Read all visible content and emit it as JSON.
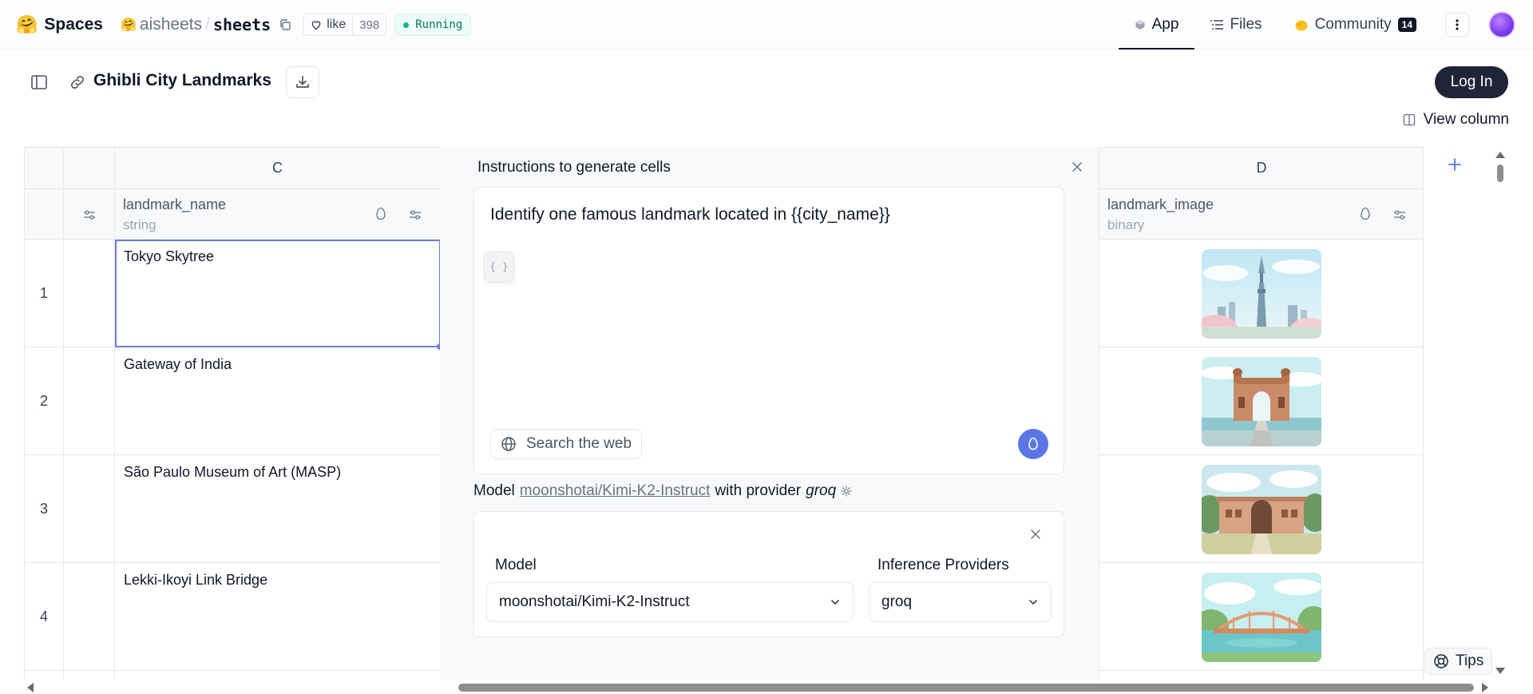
{
  "topbar": {
    "spaces_label": "Spaces",
    "owner": "aisheets",
    "separator": "/",
    "repo": "sheets",
    "like_label": "like",
    "like_count": "398",
    "status": "Running",
    "tabs": [
      {
        "label": "App"
      },
      {
        "label": "Files"
      },
      {
        "label": "Community",
        "badge": "14"
      }
    ]
  },
  "header": {
    "title": "Ghibli City Landmarks",
    "login_label": "Log In",
    "view_column_label": "View column"
  },
  "grid": {
    "columns": [
      {
        "letter": "C",
        "name": "landmark_name",
        "type": "string"
      },
      {
        "letter": "D",
        "name": "landmark_image",
        "type": "binary"
      }
    ],
    "rows": [
      {
        "num": "1",
        "landmark_name": "Tokyo Skytree",
        "image_icon": "skytree-illustration"
      },
      {
        "num": "2",
        "landmark_name": "Gateway of India",
        "image_icon": "gateway-illustration"
      },
      {
        "num": "3",
        "landmark_name": "São Paulo Museum of Art (MASP)",
        "image_icon": "museum-illustration"
      },
      {
        "num": "4",
        "landmark_name": "Lekki-Ikoyi Link Bridge",
        "image_icon": "bridge-illustration"
      }
    ]
  },
  "panel": {
    "title": "Instructions to generate cells",
    "prompt": "Identify one famous landmark located in {{city_name}}",
    "variable_button": "{ }",
    "search_web_label": "Search the web",
    "model_prefix": "Model",
    "model_link": "moonshotai/Kimi-K2-Instruct",
    "provider_prefix": "with provider",
    "provider": "groq",
    "model_label": "Model",
    "model_value": "moonshotai/Kimi-K2-Instruct",
    "providers_label": "Inference Providers",
    "provider_value": "groq"
  },
  "tips_label": "Tips",
  "colors": {
    "accent": "#5b75e6",
    "selection": "#6b7de8",
    "login_bg": "#1f2437",
    "running": "#047857"
  }
}
